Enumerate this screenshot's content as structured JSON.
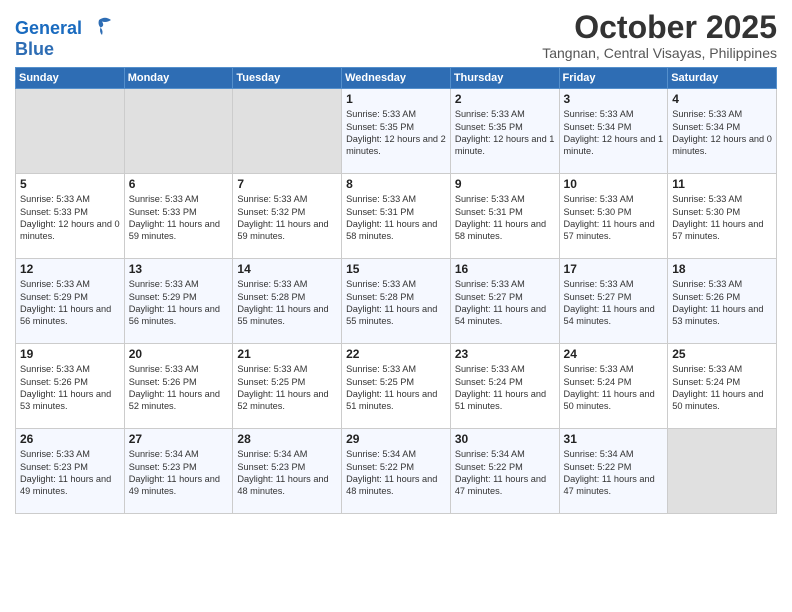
{
  "header": {
    "logo_line1": "General",
    "logo_line2": "Blue",
    "month": "October 2025",
    "location": "Tangnan, Central Visayas, Philippines"
  },
  "weekdays": [
    "Sunday",
    "Monday",
    "Tuesday",
    "Wednesday",
    "Thursday",
    "Friday",
    "Saturday"
  ],
  "weeks": [
    [
      {
        "day": "",
        "sunrise": "",
        "sunset": "",
        "daylight": "",
        "empty": true
      },
      {
        "day": "",
        "sunrise": "",
        "sunset": "",
        "daylight": "",
        "empty": true
      },
      {
        "day": "",
        "sunrise": "",
        "sunset": "",
        "daylight": "",
        "empty": true
      },
      {
        "day": "1",
        "sunrise": "Sunrise: 5:33 AM",
        "sunset": "Sunset: 5:35 PM",
        "daylight": "Daylight: 12 hours and 2 minutes."
      },
      {
        "day": "2",
        "sunrise": "Sunrise: 5:33 AM",
        "sunset": "Sunset: 5:35 PM",
        "daylight": "Daylight: 12 hours and 1 minute."
      },
      {
        "day": "3",
        "sunrise": "Sunrise: 5:33 AM",
        "sunset": "Sunset: 5:34 PM",
        "daylight": "Daylight: 12 hours and 1 minute."
      },
      {
        "day": "4",
        "sunrise": "Sunrise: 5:33 AM",
        "sunset": "Sunset: 5:34 PM",
        "daylight": "Daylight: 12 hours and 0 minutes."
      }
    ],
    [
      {
        "day": "5",
        "sunrise": "Sunrise: 5:33 AM",
        "sunset": "Sunset: 5:33 PM",
        "daylight": "Daylight: 12 hours and 0 minutes."
      },
      {
        "day": "6",
        "sunrise": "Sunrise: 5:33 AM",
        "sunset": "Sunset: 5:33 PM",
        "daylight": "Daylight: 11 hours and 59 minutes."
      },
      {
        "day": "7",
        "sunrise": "Sunrise: 5:33 AM",
        "sunset": "Sunset: 5:32 PM",
        "daylight": "Daylight: 11 hours and 59 minutes."
      },
      {
        "day": "8",
        "sunrise": "Sunrise: 5:33 AM",
        "sunset": "Sunset: 5:31 PM",
        "daylight": "Daylight: 11 hours and 58 minutes."
      },
      {
        "day": "9",
        "sunrise": "Sunrise: 5:33 AM",
        "sunset": "Sunset: 5:31 PM",
        "daylight": "Daylight: 11 hours and 58 minutes."
      },
      {
        "day": "10",
        "sunrise": "Sunrise: 5:33 AM",
        "sunset": "Sunset: 5:30 PM",
        "daylight": "Daylight: 11 hours and 57 minutes."
      },
      {
        "day": "11",
        "sunrise": "Sunrise: 5:33 AM",
        "sunset": "Sunset: 5:30 PM",
        "daylight": "Daylight: 11 hours and 57 minutes."
      }
    ],
    [
      {
        "day": "12",
        "sunrise": "Sunrise: 5:33 AM",
        "sunset": "Sunset: 5:29 PM",
        "daylight": "Daylight: 11 hours and 56 minutes."
      },
      {
        "day": "13",
        "sunrise": "Sunrise: 5:33 AM",
        "sunset": "Sunset: 5:29 PM",
        "daylight": "Daylight: 11 hours and 56 minutes."
      },
      {
        "day": "14",
        "sunrise": "Sunrise: 5:33 AM",
        "sunset": "Sunset: 5:28 PM",
        "daylight": "Daylight: 11 hours and 55 minutes."
      },
      {
        "day": "15",
        "sunrise": "Sunrise: 5:33 AM",
        "sunset": "Sunset: 5:28 PM",
        "daylight": "Daylight: 11 hours and 55 minutes."
      },
      {
        "day": "16",
        "sunrise": "Sunrise: 5:33 AM",
        "sunset": "Sunset: 5:27 PM",
        "daylight": "Daylight: 11 hours and 54 minutes."
      },
      {
        "day": "17",
        "sunrise": "Sunrise: 5:33 AM",
        "sunset": "Sunset: 5:27 PM",
        "daylight": "Daylight: 11 hours and 54 minutes."
      },
      {
        "day": "18",
        "sunrise": "Sunrise: 5:33 AM",
        "sunset": "Sunset: 5:26 PM",
        "daylight": "Daylight: 11 hours and 53 minutes."
      }
    ],
    [
      {
        "day": "19",
        "sunrise": "Sunrise: 5:33 AM",
        "sunset": "Sunset: 5:26 PM",
        "daylight": "Daylight: 11 hours and 53 minutes."
      },
      {
        "day": "20",
        "sunrise": "Sunrise: 5:33 AM",
        "sunset": "Sunset: 5:26 PM",
        "daylight": "Daylight: 11 hours and 52 minutes."
      },
      {
        "day": "21",
        "sunrise": "Sunrise: 5:33 AM",
        "sunset": "Sunset: 5:25 PM",
        "daylight": "Daylight: 11 hours and 52 minutes."
      },
      {
        "day": "22",
        "sunrise": "Sunrise: 5:33 AM",
        "sunset": "Sunset: 5:25 PM",
        "daylight": "Daylight: 11 hours and 51 minutes."
      },
      {
        "day": "23",
        "sunrise": "Sunrise: 5:33 AM",
        "sunset": "Sunset: 5:24 PM",
        "daylight": "Daylight: 11 hours and 51 minutes."
      },
      {
        "day": "24",
        "sunrise": "Sunrise: 5:33 AM",
        "sunset": "Sunset: 5:24 PM",
        "daylight": "Daylight: 11 hours and 50 minutes."
      },
      {
        "day": "25",
        "sunrise": "Sunrise: 5:33 AM",
        "sunset": "Sunset: 5:24 PM",
        "daylight": "Daylight: 11 hours and 50 minutes."
      }
    ],
    [
      {
        "day": "26",
        "sunrise": "Sunrise: 5:33 AM",
        "sunset": "Sunset: 5:23 PM",
        "daylight": "Daylight: 11 hours and 49 minutes."
      },
      {
        "day": "27",
        "sunrise": "Sunrise: 5:34 AM",
        "sunset": "Sunset: 5:23 PM",
        "daylight": "Daylight: 11 hours and 49 minutes."
      },
      {
        "day": "28",
        "sunrise": "Sunrise: 5:34 AM",
        "sunset": "Sunset: 5:23 PM",
        "daylight": "Daylight: 11 hours and 48 minutes."
      },
      {
        "day": "29",
        "sunrise": "Sunrise: 5:34 AM",
        "sunset": "Sunset: 5:22 PM",
        "daylight": "Daylight: 11 hours and 48 minutes."
      },
      {
        "day": "30",
        "sunrise": "Sunrise: 5:34 AM",
        "sunset": "Sunset: 5:22 PM",
        "daylight": "Daylight: 11 hours and 47 minutes."
      },
      {
        "day": "31",
        "sunrise": "Sunrise: 5:34 AM",
        "sunset": "Sunset: 5:22 PM",
        "daylight": "Daylight: 11 hours and 47 minutes."
      },
      {
        "day": "",
        "sunrise": "",
        "sunset": "",
        "daylight": "",
        "empty": true
      }
    ]
  ]
}
